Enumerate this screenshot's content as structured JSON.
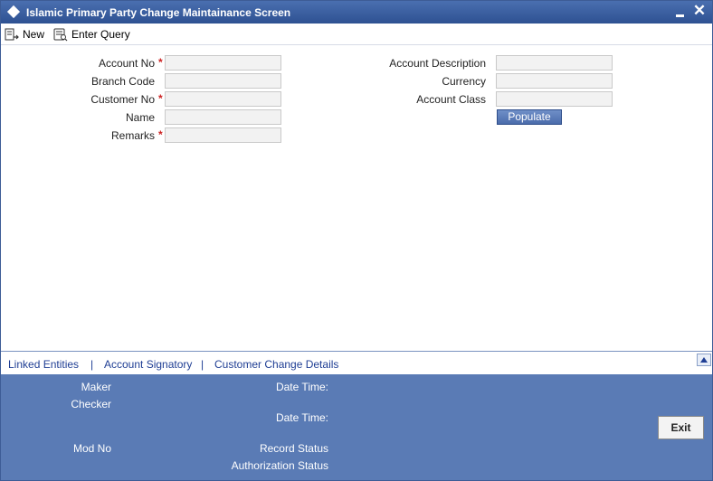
{
  "window": {
    "title": "Islamic Primary Party Change Maintainance Screen",
    "close_glyph": "✕"
  },
  "toolbar": {
    "new_label": "New",
    "enter_query_label": "Enter Query"
  },
  "form": {
    "left_fields": [
      {
        "label": "Account No",
        "required": true,
        "value": ""
      },
      {
        "label": "Branch Code",
        "required": false,
        "value": ""
      },
      {
        "label": "Customer No",
        "required": true,
        "value": ""
      },
      {
        "label": "Name",
        "required": false,
        "value": ""
      },
      {
        "label": "Remarks",
        "required": true,
        "value": ""
      }
    ],
    "right_fields": [
      {
        "label": "Account Description",
        "value": ""
      },
      {
        "label": "Currency",
        "value": ""
      },
      {
        "label": "Account Class",
        "value": ""
      }
    ],
    "required_marker": "*",
    "populate_label": "Populate"
  },
  "links": {
    "items": [
      "Linked Entities",
      "Account Signatory",
      "Customer Change Details"
    ],
    "separator": "|"
  },
  "footer": {
    "maker": "Maker",
    "checker": "Checker",
    "mod_no": "Mod No",
    "date_time_1": "Date Time:",
    "date_time_2": "Date Time:",
    "record_status": "Record Status",
    "authorization_status": "Authorization Status",
    "exit_label": "Exit"
  },
  "colors": {
    "title_bar": "#2e5192",
    "footer_bg": "#5a7bb5",
    "link_color": "#1f3e94",
    "required_color": "#cc2222"
  }
}
